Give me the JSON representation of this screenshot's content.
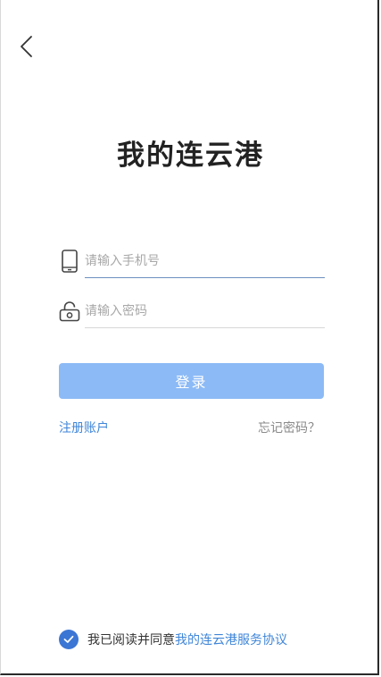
{
  "header": {
    "back_icon": "chevron-left-icon"
  },
  "app_title": "我的连云港",
  "form": {
    "phone": {
      "icon": "phone-icon",
      "placeholder": "请输入手机号",
      "value": ""
    },
    "password": {
      "icon": "lock-icon",
      "placeholder": "请输入密码",
      "value": ""
    },
    "login_label": "登录"
  },
  "links": {
    "register": "注册账户",
    "forgot": "忘记密码？"
  },
  "agreement": {
    "checked": true,
    "prefix": "我已阅读并同意",
    "link": "我的连云港服务协议"
  },
  "colors": {
    "accent": "#3f86d8",
    "button_bg": "#8cbaf6",
    "checkbox": "#3c76d4"
  }
}
